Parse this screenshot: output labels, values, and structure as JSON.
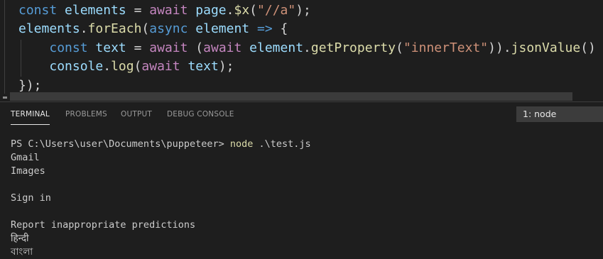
{
  "editor": {
    "lines": [
      [
        {
          "t": "const",
          "c": "kw"
        },
        {
          "t": " ",
          "c": "plain"
        },
        {
          "t": "elements",
          "c": "var"
        },
        {
          "t": " = ",
          "c": "plain"
        },
        {
          "t": "await",
          "c": "ctl"
        },
        {
          "t": " ",
          "c": "plain"
        },
        {
          "t": "page",
          "c": "var"
        },
        {
          "t": ".",
          "c": "plain"
        },
        {
          "t": "$x",
          "c": "fn"
        },
        {
          "t": "(",
          "c": "plain"
        },
        {
          "t": "\"//a\"",
          "c": "str"
        },
        {
          "t": ");",
          "c": "plain"
        }
      ],
      [
        {
          "t": "elements",
          "c": "var"
        },
        {
          "t": ".",
          "c": "plain"
        },
        {
          "t": "forEach",
          "c": "fn"
        },
        {
          "t": "(",
          "c": "plain"
        },
        {
          "t": "async",
          "c": "kw"
        },
        {
          "t": " ",
          "c": "plain"
        },
        {
          "t": "element",
          "c": "var"
        },
        {
          "t": " ",
          "c": "plain"
        },
        {
          "t": "=>",
          "c": "kw"
        },
        {
          "t": " {",
          "c": "plain"
        }
      ],
      [
        {
          "t": "    ",
          "c": "plain"
        },
        {
          "t": "const",
          "c": "kw"
        },
        {
          "t": " ",
          "c": "plain"
        },
        {
          "t": "text",
          "c": "var"
        },
        {
          "t": " = ",
          "c": "plain"
        },
        {
          "t": "await",
          "c": "ctl"
        },
        {
          "t": " (",
          "c": "plain"
        },
        {
          "t": "await",
          "c": "ctl"
        },
        {
          "t": " ",
          "c": "plain"
        },
        {
          "t": "element",
          "c": "var"
        },
        {
          "t": ".",
          "c": "plain"
        },
        {
          "t": "getProperty",
          "c": "fn"
        },
        {
          "t": "(",
          "c": "plain"
        },
        {
          "t": "\"innerText\"",
          "c": "str"
        },
        {
          "t": ")).",
          "c": "plain"
        },
        {
          "t": "jsonValue",
          "c": "fn"
        },
        {
          "t": "()",
          "c": "plain"
        }
      ],
      [
        {
          "t": "    ",
          "c": "plain"
        },
        {
          "t": "console",
          "c": "var"
        },
        {
          "t": ".",
          "c": "plain"
        },
        {
          "t": "log",
          "c": "fn"
        },
        {
          "t": "(",
          "c": "plain"
        },
        {
          "t": "await",
          "c": "ctl"
        },
        {
          "t": " ",
          "c": "plain"
        },
        {
          "t": "text",
          "c": "var"
        },
        {
          "t": ");",
          "c": "plain"
        }
      ],
      [
        {
          "t": "});",
          "c": "plain"
        }
      ]
    ]
  },
  "panel": {
    "tabs": {
      "terminal": "TERMINAL",
      "problems": "PROBLEMS",
      "output": "OUTPUT",
      "debug_console": "DEBUG CONSOLE"
    },
    "terminal_select": "1: node"
  },
  "terminal": {
    "prompt": "PS C:\\Users\\user\\Documents\\puppeteer> ",
    "command": "node",
    "args": " .\\test.js",
    "output": [
      "Gmail",
      "Images",
      "",
      "Sign in",
      "",
      "Report inappropriate predictions",
      "हिन्दी",
      "বাংলা"
    ]
  }
}
